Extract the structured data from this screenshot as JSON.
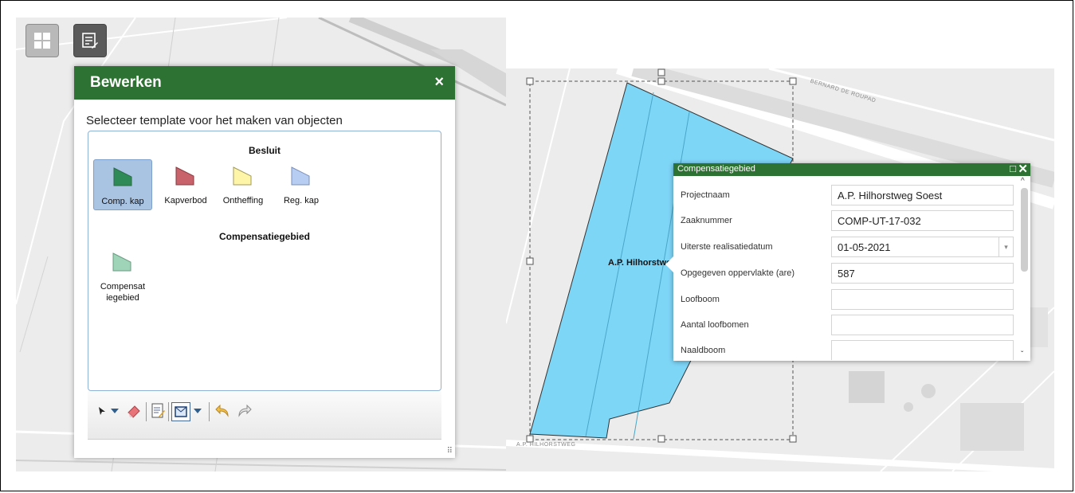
{
  "map_buttons": {
    "grid_icon": "grid-icon",
    "edit_icon": "edit-list-icon"
  },
  "edit_panel": {
    "title": "Bewerken",
    "close": "×",
    "instruction": "Selecteer template voor het maken van objecten",
    "groups": [
      {
        "title": "Besluit",
        "templates": [
          {
            "label": "Comp. kap",
            "color": "#2e8b57",
            "selected": true
          },
          {
            "label": "Kapverbod",
            "color": "#c9636b",
            "selected": false
          },
          {
            "label": "Ontheffing",
            "color": "#fff5a8",
            "selected": false
          },
          {
            "label": "Reg. kap",
            "color": "#b8cdf2",
            "selected": false
          }
        ]
      },
      {
        "title": "Compensatiegebied",
        "templates": [
          {
            "label": "Compensat iegebied",
            "color": "#9fd4b8",
            "selected": false
          }
        ]
      }
    ],
    "toolbar": [
      "select-arrow-icon",
      "dropdown-icon",
      "eraser-icon",
      "attributes-icon",
      "polygon-icon",
      "dropdown-icon",
      "undo-icon",
      "redo-icon"
    ],
    "resize": "⠿"
  },
  "map": {
    "feature_label": "A.P. Hilhorstwe",
    "streets": [
      "BERNARD DE ROUPAD",
      "A.P. HILHORSTWEG"
    ],
    "feature_color": "#7ed6f7"
  },
  "popup": {
    "title": "Compensatiegebied",
    "maximize": "□",
    "close": "✕",
    "fields": [
      {
        "label": "Projectnaam",
        "value": "A.P. Hilhorstweg Soest"
      },
      {
        "label": "Zaaknummer",
        "value": "COMP-UT-17-032"
      },
      {
        "label": "Uiterste realisatiedatum",
        "value": "01-05-2021",
        "dropdown": "▾"
      },
      {
        "label": "Opgegeven oppervlakte (are)",
        "value": "587"
      },
      {
        "label": "Loofboom",
        "value": ""
      },
      {
        "label": "Aantal loofbomen",
        "value": ""
      },
      {
        "label": "Naaldboom",
        "value": ""
      }
    ],
    "scroll_up": "^",
    "scroll_down": "ˇ"
  }
}
